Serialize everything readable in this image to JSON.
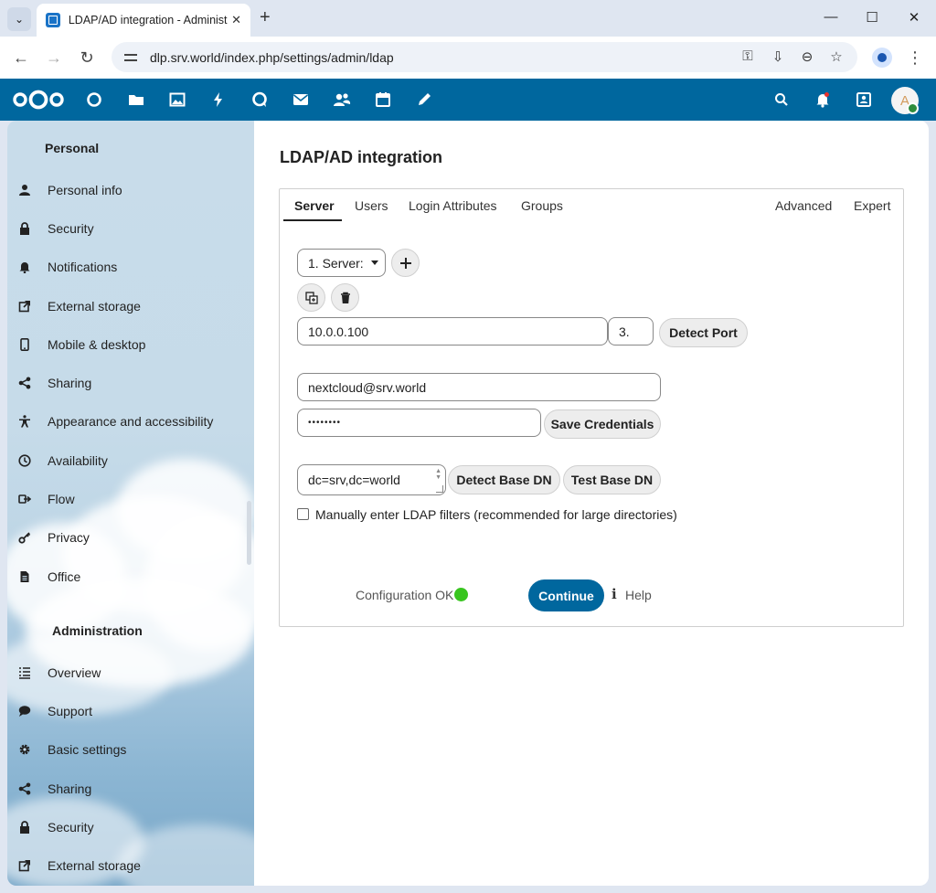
{
  "browser": {
    "tab_title": "LDAP/AD integration - Administ",
    "url": "dlp.srv.world/index.php/settings/admin/ldap"
  },
  "nextcloud": {
    "avatar_initial": "A",
    "brand_color": "#00679e",
    "status_ok_color": "#38c51f"
  },
  "sidebar": {
    "personal_heading": "Personal",
    "personal_items": [
      {
        "label": "Personal info",
        "icon": "person-icon"
      },
      {
        "label": "Security",
        "icon": "lock-icon"
      },
      {
        "label": "Notifications",
        "icon": "bell-icon"
      },
      {
        "label": "External storage",
        "icon": "external-link-icon"
      },
      {
        "label": "Mobile & desktop",
        "icon": "phone-icon"
      },
      {
        "label": "Sharing",
        "icon": "share-icon"
      },
      {
        "label": "Appearance and accessibility",
        "icon": "accessibility-icon"
      },
      {
        "label": "Availability",
        "icon": "clock-icon"
      },
      {
        "label": "Flow",
        "icon": "flow-icon"
      },
      {
        "label": "Privacy",
        "icon": "key-icon"
      },
      {
        "label": "Office",
        "icon": "document-icon"
      }
    ],
    "admin_heading": "Administration",
    "admin_items": [
      {
        "label": "Overview",
        "icon": "list-icon"
      },
      {
        "label": "Support",
        "icon": "chat-bubble-icon"
      },
      {
        "label": "Basic settings",
        "icon": "gear-icon"
      },
      {
        "label": "Sharing",
        "icon": "share-icon"
      },
      {
        "label": "Security",
        "icon": "lock-icon"
      },
      {
        "label": "External storage",
        "icon": "external-link-icon"
      }
    ]
  },
  "page": {
    "title": "LDAP/AD integration",
    "tabs_left": [
      "Server",
      "Users",
      "Login Attributes",
      "Groups"
    ],
    "tabs_right": [
      "Advanced",
      "Expert"
    ],
    "active_tab": "Server",
    "server_select": "1. Server:",
    "host": "10.0.0.100",
    "port": "3.",
    "detect_port": "Detect Port",
    "user_dn": "nextcloud@srv.world",
    "password_mask": "••••••••",
    "save_credentials": "Save Credentials",
    "base_dn": "dc=srv,dc=world",
    "detect_base_dn": "Detect Base DN",
    "test_base_dn": "Test Base DN",
    "manual_filters_label": "Manually enter LDAP filters (recommended for large directories)",
    "manual_filters_checked": false,
    "status": "Configuration OK",
    "continue": "Continue",
    "help": "Help"
  }
}
